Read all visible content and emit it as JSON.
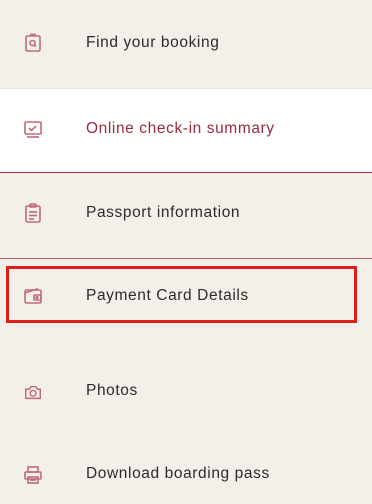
{
  "menu": {
    "items": [
      {
        "label": "Find your booking",
        "icon": "booking-search-icon"
      },
      {
        "label": "Online check-in summary",
        "icon": "checkin-summary-icon",
        "active": true
      },
      {
        "label": "Passport information",
        "icon": "passport-clipboard-icon"
      },
      {
        "label": "Payment Card Details",
        "icon": "payment-wallet-icon",
        "highlighted": true
      },
      {
        "label": "Photos",
        "icon": "camera-icon"
      },
      {
        "label": "Download boarding pass",
        "icon": "printer-icon"
      }
    ]
  },
  "colors": {
    "background": "#f3f0ea",
    "icon": "#c26a78",
    "active_text": "#9b2a40",
    "highlight_box": "#e01e1e"
  }
}
